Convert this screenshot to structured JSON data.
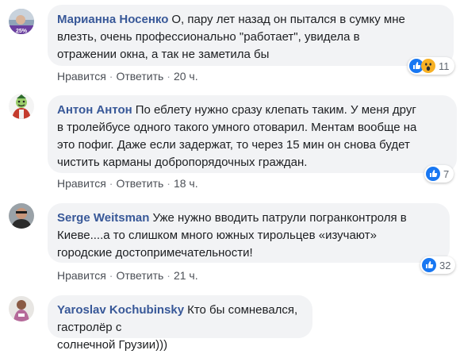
{
  "comments": [
    {
      "author": "Марианна Носенко",
      "text_lines": [
        "О, пару лет назад он пытался в сумку мне",
        "влезть, очень профессионально \"работает\", увидела в",
        "отражении окна, а так не заметила бы"
      ],
      "avatar_badge": "25%",
      "like_label": "Нравится",
      "reply_label": "Ответить",
      "time": "20 ч.",
      "reaction_count": "11",
      "reaction_icons": [
        "like-icon",
        "wow-icon"
      ]
    },
    {
      "author": "Антон Антон",
      "text_lines": [
        "По еблету нужно сразу клепать таким. У меня друг",
        "в тролейбусе одного такого умного отоварил. Ментам вообще на",
        "это пофиг. Даже если задержат, то через 15 мин он снова будет",
        "чистить карманы добропорядочных граждан."
      ],
      "like_label": "Нравится",
      "reply_label": "Ответить",
      "time": "18 ч.",
      "reaction_count": "7",
      "reaction_icons": [
        "like-icon"
      ]
    },
    {
      "author": "Serge Weitsman",
      "text_lines": [
        "Уже нужно вводить патрули погранконтроля в",
        "Киеве....а то слишком много южных тирольцев «изучают»",
        "городские достопримечательности!"
      ],
      "like_label": "Нравится",
      "reply_label": "Ответить",
      "time": "21 ч.",
      "reaction_count": "32",
      "reaction_icons": [
        "like-icon"
      ]
    },
    {
      "author": "Yaroslav Kochubinsky",
      "text_lines": [
        "Кто бы сомневался, гастролёр с",
        "солнечной Грузии)))"
      ]
    }
  ],
  "colors": {
    "author": "#385898",
    "bubble": "#f2f3f5",
    "like_blue": "#1877f2",
    "meta": "#606770"
  }
}
